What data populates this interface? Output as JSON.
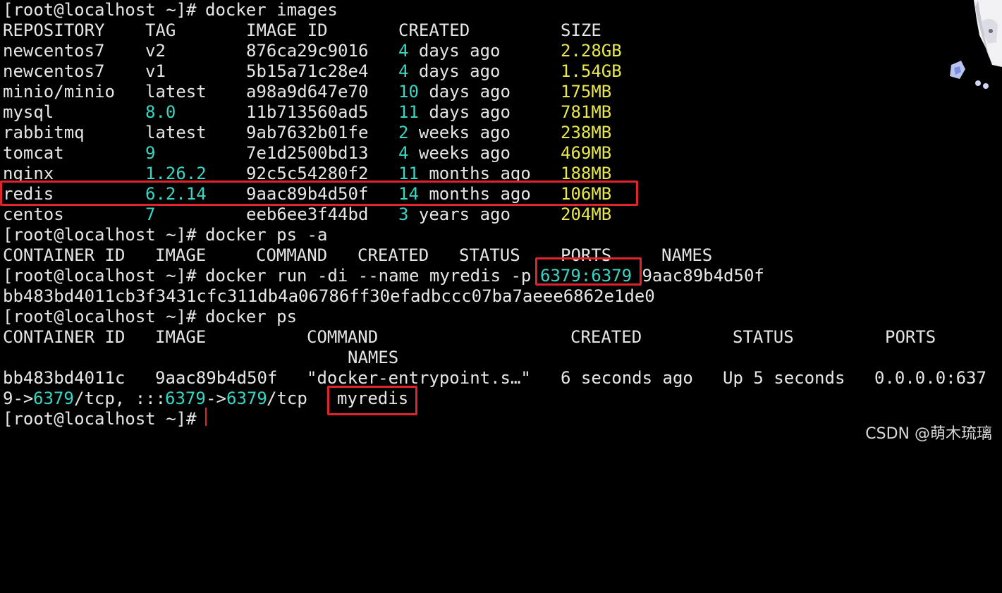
{
  "prompt": "[root@localhost ~]#",
  "commands": {
    "images": "docker images",
    "ps_a": "docker ps -a",
    "run_pre": "docker run -di --name myredis -p ",
    "run_port": "6379:6379",
    "run_post": " 9aac89b4d50f",
    "ps": "docker ps"
  },
  "images_table": {
    "headers": [
      "REPOSITORY",
      "TAG",
      "IMAGE ID",
      "CREATED",
      "SIZE"
    ],
    "rows": [
      {
        "repo": "newcentos7",
        "tag": "v2",
        "id": "876ca29c9016",
        "created_num": "4",
        "created_unit": " days ago",
        "size": "2.28GB"
      },
      {
        "repo": "newcentos7",
        "tag": "v1",
        "id": "5b15a71c28e4",
        "created_num": "4",
        "created_unit": " days ago",
        "size": "1.54GB"
      },
      {
        "repo": "minio/minio",
        "tag": "latest",
        "id": "a98a9d647e70",
        "created_num": "10",
        "created_unit": " days ago",
        "size": "175MB"
      },
      {
        "repo": "mysql",
        "tag": "8.0",
        "id": "11b713560ad5",
        "created_num": "11",
        "created_unit": " days ago",
        "size": "781MB"
      },
      {
        "repo": "rabbitmq",
        "tag": "latest",
        "id": "9ab7632b01fe",
        "created_num": "2",
        "created_unit": " weeks ago",
        "size": "238MB"
      },
      {
        "repo": "tomcat",
        "tag": "9",
        "id": "7e1d2500bd13",
        "created_num": "4",
        "created_unit": " weeks ago",
        "size": "469MB"
      },
      {
        "repo": "nginx",
        "tag": "1.26.2",
        "id": "92c5c54280f2",
        "created_num": "11",
        "created_unit": " months ago",
        "size": "188MB"
      },
      {
        "repo": "redis",
        "tag": "6.2.14",
        "id": "9aac89b4d50f",
        "created_num": "14",
        "created_unit": " months ago",
        "size": "106MB"
      },
      {
        "repo": "centos",
        "tag": "7",
        "id": "eeb6ee3f44bd",
        "created_num": "3",
        "created_unit": " years ago",
        "size": "204MB"
      }
    ]
  },
  "ps_a_headers": [
    "CONTAINER ID",
    "IMAGE",
    "COMMAND",
    "CREATED",
    "STATUS",
    "PORTS",
    "NAMES"
  ],
  "container_hash": "bb483bd4011cb3f3431cfc311db4a06786ff30efadbccc07ba7aeee6862e1de0",
  "ps_headers": [
    "CONTAINER ID",
    "IMAGE",
    "COMMAND",
    "CREATED",
    "STATUS",
    "PORTS",
    "NAMES"
  ],
  "ps_row": {
    "container_id": "bb483bd4011c",
    "image": "9aac89b4d50f",
    "command": "\"docker-entrypoint.s…\"",
    "created": "6 seconds ago",
    "status": "Up 5 seconds",
    "ports_a": "0.0.0.0:637",
    "ports_b1": "9->",
    "ports_b2": "6379",
    "ports_b3": "/tcp, :::",
    "ports_b4": "6379",
    "ports_b5": "->",
    "ports_b6": "6379",
    "ports_b7": "/tcp",
    "name": "myredis"
  },
  "watermark": "CSDN @萌木琉璃",
  "colors": {
    "background": "#000000",
    "text": "#e6e6e6",
    "number": "#37d6c5",
    "size": "#e8e84c",
    "highlight": "#e0242c"
  }
}
